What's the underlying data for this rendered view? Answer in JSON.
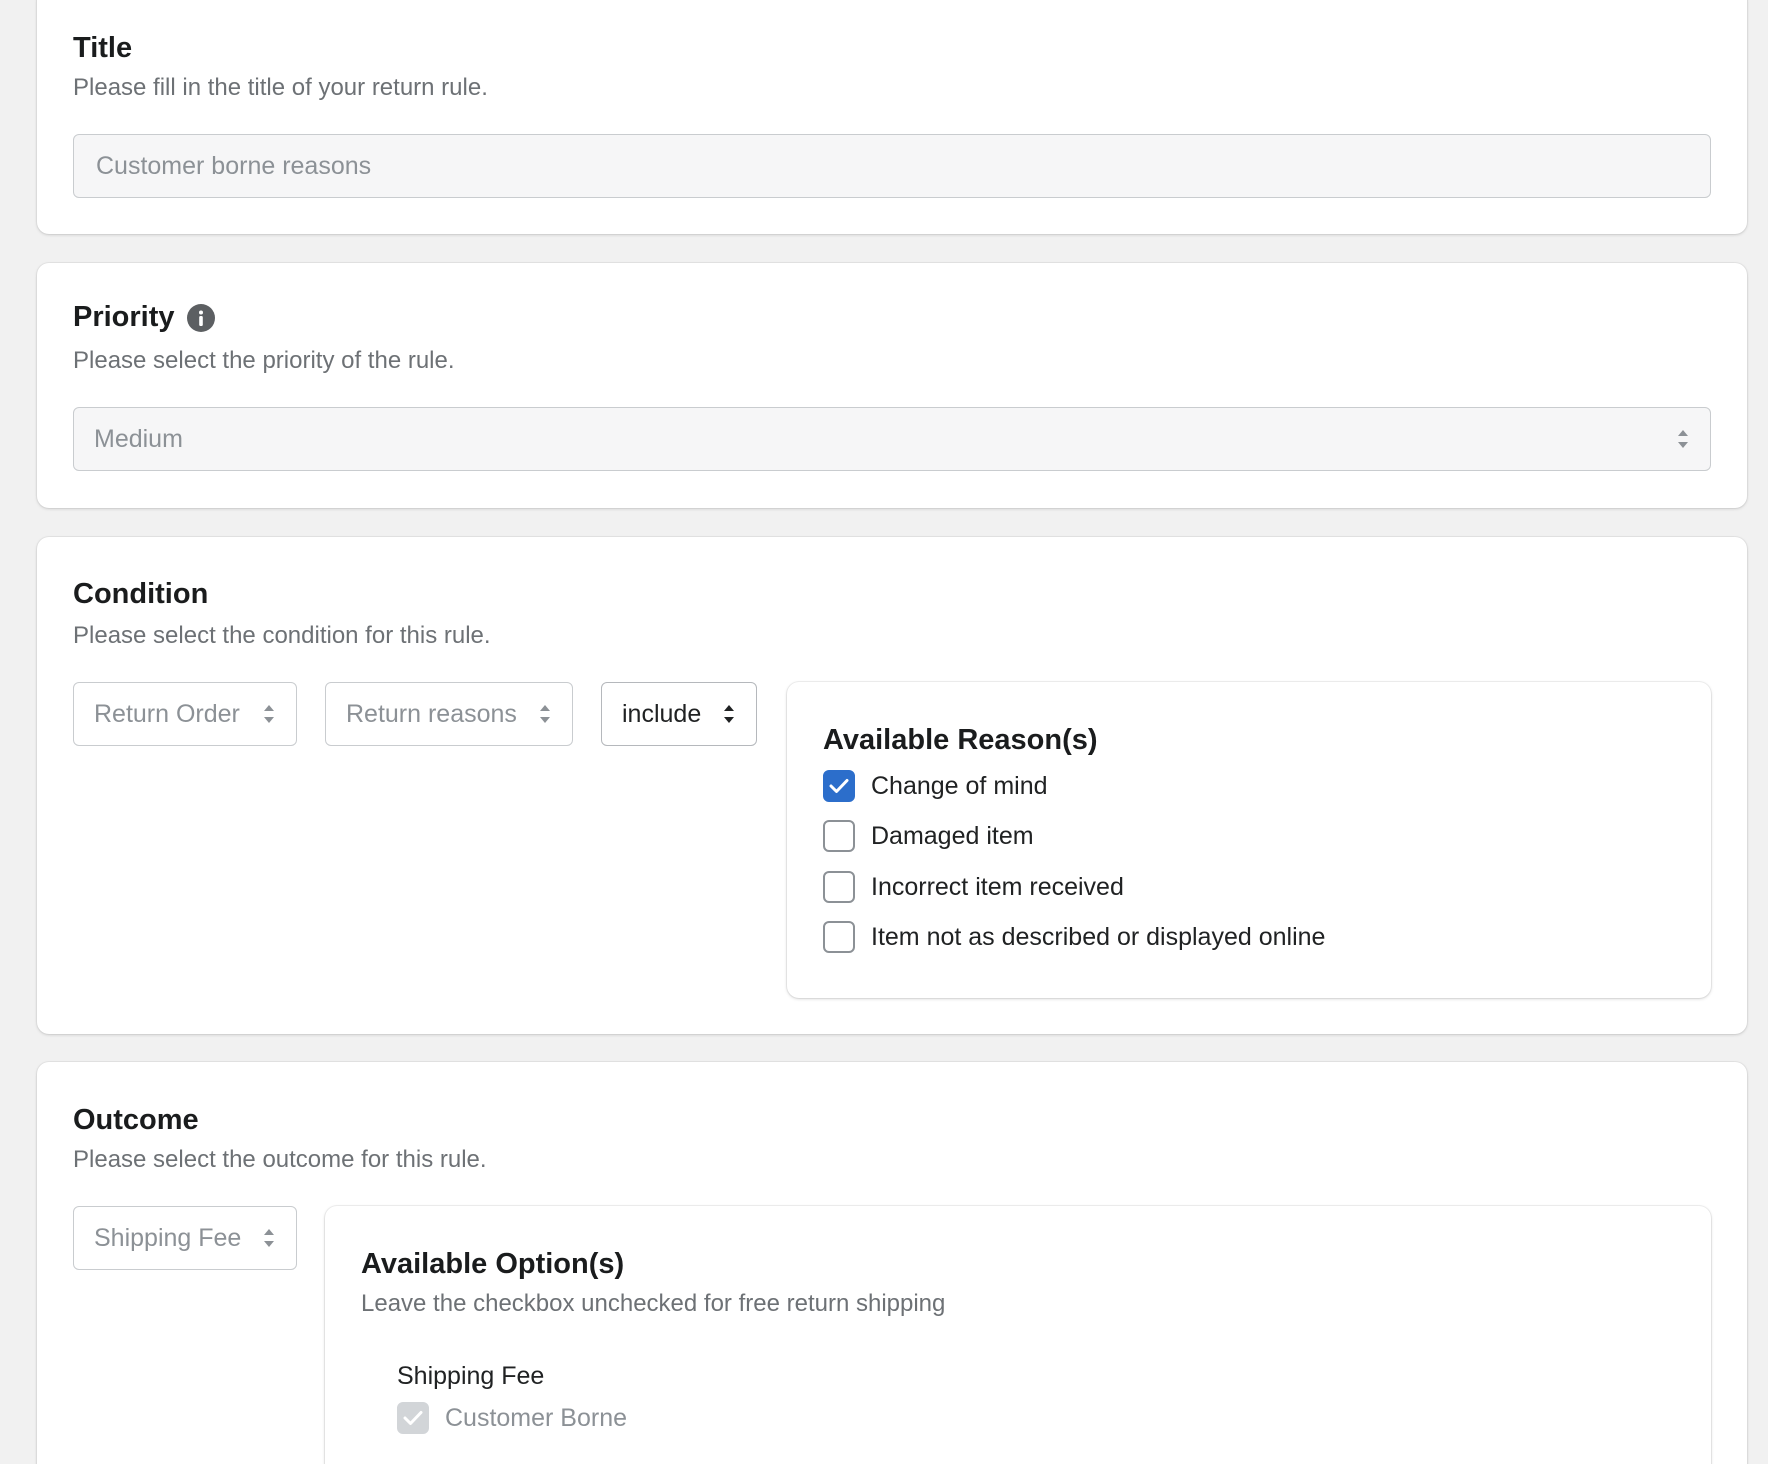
{
  "title_card": {
    "heading": "Title",
    "description": "Please fill in the title of your return rule.",
    "input_value": "Customer borne reasons"
  },
  "priority_card": {
    "heading": "Priority",
    "info_icon": "info-icon",
    "description": "Please select the priority of the rule.",
    "selected": "Medium"
  },
  "condition_card": {
    "heading": "Condition",
    "description": "Please select the condition for this rule.",
    "selects": {
      "subject": "Return Order",
      "field": "Return reasons",
      "operator": "include"
    },
    "reasons_panel": {
      "heading": "Available Reason(s)",
      "items": [
        {
          "label": "Change of mind",
          "checked": true
        },
        {
          "label": "Damaged item",
          "checked": false
        },
        {
          "label": "Incorrect item received",
          "checked": false
        },
        {
          "label": "Item not as described or displayed online",
          "checked": false
        }
      ]
    }
  },
  "outcome_card": {
    "heading": "Outcome",
    "description": "Please select the outcome for this rule.",
    "select": "Shipping Fee",
    "options_panel": {
      "heading": "Available Option(s)",
      "description": "Leave the checkbox unchecked for free return shipping",
      "group_label": "Shipping Fee",
      "option": {
        "label": "Customer Borne",
        "checked": true,
        "disabled": true
      }
    }
  },
  "colors": {
    "accent": "#2c6ecb",
    "background": "#f1f1f1",
    "muted_text": "#6d7175"
  }
}
